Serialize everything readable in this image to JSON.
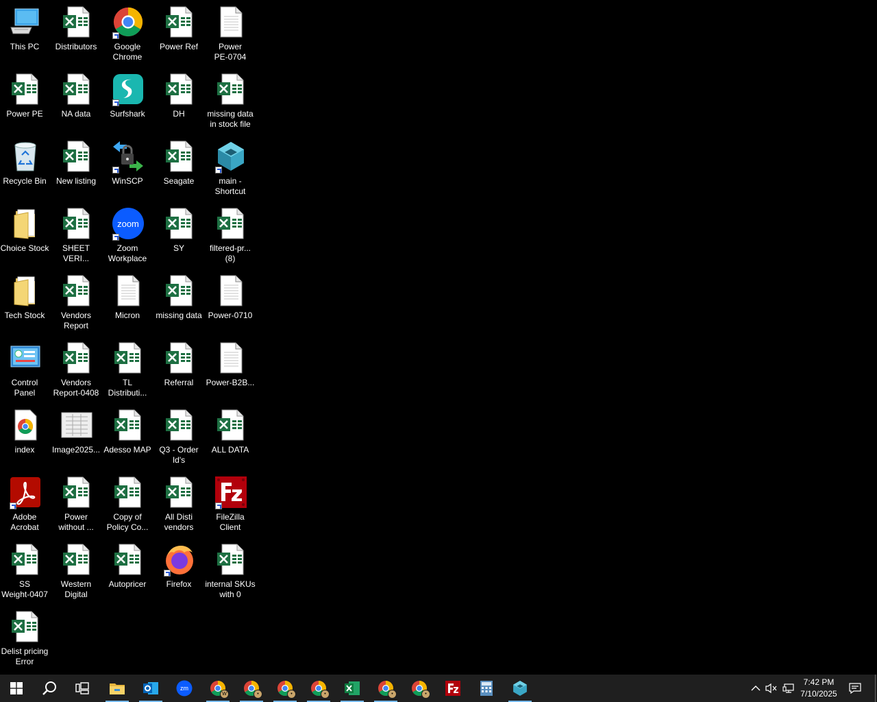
{
  "desktop": {
    "icons": [
      {
        "label": "This PC",
        "type": "pc"
      },
      {
        "label": "Distributors",
        "type": "excel"
      },
      {
        "label": "Google\nChrome",
        "type": "chrome",
        "shortcut": true
      },
      {
        "label": "Power Ref",
        "type": "excel"
      },
      {
        "label": "Power\nPE-0704",
        "type": "doc"
      },
      {
        "label": "Power PE",
        "type": "excel"
      },
      {
        "label": "NA data",
        "type": "excel"
      },
      {
        "label": "Surfshark",
        "type": "surfshark",
        "shortcut": true
      },
      {
        "label": "DH",
        "type": "excel"
      },
      {
        "label": "missing data\nin stock file",
        "type": "excel"
      },
      {
        "label": "Recycle Bin",
        "type": "bin"
      },
      {
        "label": "New listing",
        "type": "excel"
      },
      {
        "label": "WinSCP",
        "type": "winscp",
        "shortcut": true
      },
      {
        "label": "Seagate",
        "type": "excel"
      },
      {
        "label": "main -\nShortcut",
        "type": "main",
        "shortcut": true
      },
      {
        "label": "Choice Stock",
        "type": "folder"
      },
      {
        "label": "SHEET\nVERI...",
        "type": "excel"
      },
      {
        "label": "Zoom\nWorkplace",
        "type": "zoom",
        "shortcut": true
      },
      {
        "label": "SY",
        "type": "excel"
      },
      {
        "label": "filtered-pr...\n(8)",
        "type": "excel"
      },
      {
        "label": "Tech Stock",
        "type": "folder"
      },
      {
        "label": "Vendors\nReport",
        "type": "excel"
      },
      {
        "label": "Micron",
        "type": "doc"
      },
      {
        "label": "missing data",
        "type": "excel"
      },
      {
        "label": "Power-0710",
        "type": "doc"
      },
      {
        "label": "Control\nPanel",
        "type": "control"
      },
      {
        "label": "Vendors\nReport-0408",
        "type": "excel"
      },
      {
        "label": "TL\nDistributi...",
        "type": "excel"
      },
      {
        "label": "Referral",
        "type": "excel"
      },
      {
        "label": "Power-B2B...",
        "type": "doc"
      },
      {
        "label": "index",
        "type": "chromefile"
      },
      {
        "label": "Image2025...",
        "type": "image"
      },
      {
        "label": "Adesso MAP",
        "type": "excel"
      },
      {
        "label": "Q3 - Order\nId's",
        "type": "excel"
      },
      {
        "label": "ALL DATA",
        "type": "excel"
      },
      {
        "label": "Adobe\nAcrobat",
        "type": "acrobat",
        "shortcut": true
      },
      {
        "label": "Power\nwithout ...",
        "type": "excel"
      },
      {
        "label": "Copy of\nPolicy Co...",
        "type": "excel"
      },
      {
        "label": "All Disti\nvendors",
        "type": "excel"
      },
      {
        "label": "FileZilla\nClient",
        "type": "filezilla",
        "shortcut": true
      },
      {
        "label": "SS\nWeight-0407",
        "type": "excel"
      },
      {
        "label": "Western\nDigital",
        "type": "excel"
      },
      {
        "label": "Autopricer",
        "type": "excel"
      },
      {
        "label": "Firefox",
        "type": "firefox",
        "shortcut": true
      },
      {
        "label": "internal SKUs\nwith 0",
        "type": "excel"
      },
      {
        "label": "Delist pricing\nError",
        "type": "excel"
      }
    ]
  },
  "taskbar": {
    "apps": [
      {
        "name": "start",
        "icon": "windows-icon"
      },
      {
        "name": "search",
        "icon": "search-icon"
      },
      {
        "name": "task-view",
        "icon": "task-view-icon"
      },
      {
        "name": "file-explorer",
        "icon": "folder-icon",
        "active": true
      },
      {
        "name": "outlook",
        "icon": "outlook-icon",
        "active": true
      },
      {
        "name": "zoom",
        "icon": "zoom-icon"
      },
      {
        "name": "chrome-profile-w",
        "icon": "chrome-icon",
        "badge": "W",
        "active": true
      },
      {
        "name": "chrome-profile-2",
        "icon": "chrome-icon",
        "badge": "•",
        "active": true
      },
      {
        "name": "chrome-profile-3",
        "icon": "chrome-icon",
        "badge": "•",
        "active": true
      },
      {
        "name": "chrome-profile-4",
        "icon": "chrome-icon",
        "badge": "•",
        "active": true
      },
      {
        "name": "excel",
        "icon": "excel-icon",
        "active": true
      },
      {
        "name": "chrome-profile-5",
        "icon": "chrome-icon",
        "badge": "•",
        "active": true
      },
      {
        "name": "chrome-profile-6",
        "icon": "chrome-icon",
        "badge": "•"
      },
      {
        "name": "filezilla",
        "icon": "filezilla-icon"
      },
      {
        "name": "calculator",
        "icon": "calculator-icon"
      },
      {
        "name": "main-app",
        "icon": "main-app-icon",
        "active": true
      }
    ],
    "clock": {
      "time": "7:42 PM",
      "date": "7/10/2025"
    }
  },
  "colors": {
    "excel": "#1d6f42",
    "taskbar": "#1f1f1f",
    "accent": "#76b9ed"
  }
}
